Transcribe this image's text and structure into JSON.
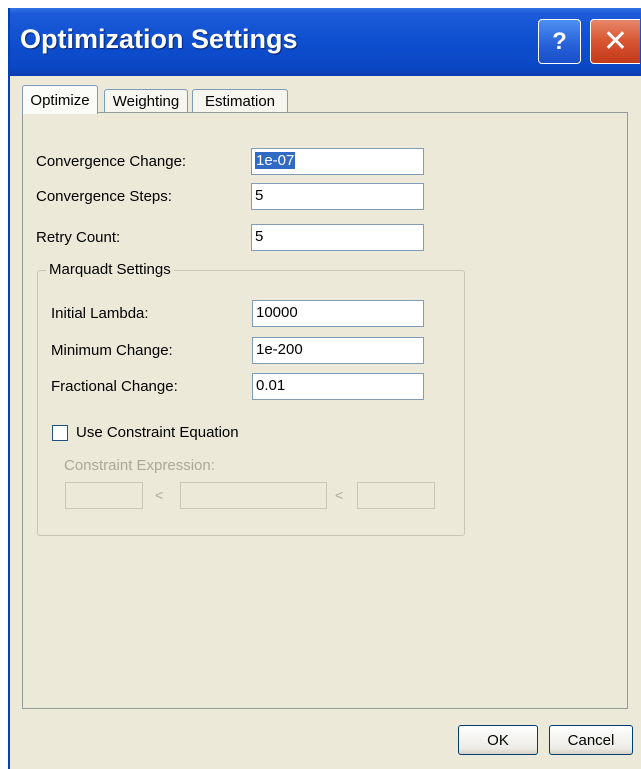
{
  "window": {
    "title": "Optimization Settings",
    "help_label": "?",
    "close_label": "✕"
  },
  "tabs": [
    {
      "label": "Optimize",
      "active": true
    },
    {
      "label": "Weighting",
      "active": false
    },
    {
      "label": "Estimation",
      "active": false
    }
  ],
  "optimize": {
    "convergence_change_label": "Convergence Change:",
    "convergence_change_value": "1e-07",
    "convergence_steps_label": "Convergence Steps:",
    "convergence_steps_value": "5",
    "retry_count_label": "Retry Count:",
    "retry_count_value": "5"
  },
  "marquadt": {
    "group_title": "Marquadt Settings",
    "initial_lambda_label": "Initial Lambda:",
    "initial_lambda_value": "10000",
    "minimum_change_label": "Minimum Change:",
    "minimum_change_value": "1e-200",
    "fractional_change_label": "Fractional Change:",
    "fractional_change_value": "0.01",
    "use_constraint_label": "Use Constraint Equation",
    "use_constraint_checked": false,
    "constraint_expression_label": "Constraint Expression:",
    "lt_symbol_1": "<",
    "lt_symbol_2": "<"
  },
  "buttons": {
    "ok": "OK",
    "cancel": "Cancel"
  }
}
